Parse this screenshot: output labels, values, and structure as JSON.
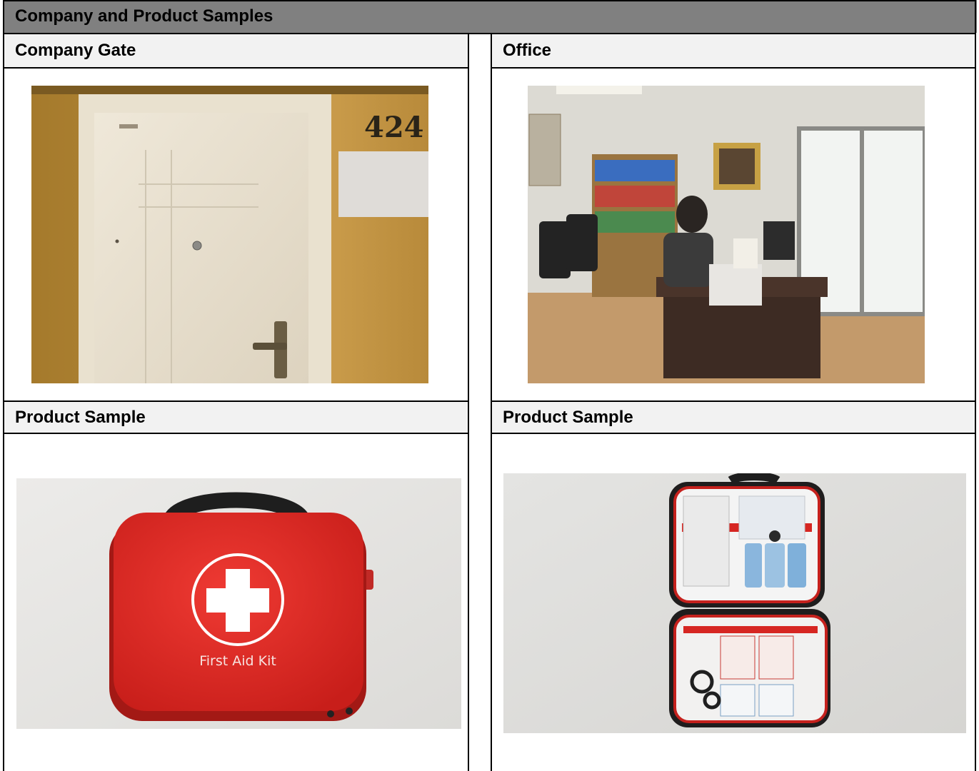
{
  "document": {
    "title": "Company and Product Samples",
    "cells": [
      {
        "label": "Company Gate",
        "photo": "company-door",
        "door_number": "424"
      },
      {
        "label": "Office",
        "photo": "office-room"
      },
      {
        "label": "Product Sample",
        "photo": "first-aid-kit-closed",
        "kit_text": "First Aid Kit"
      },
      {
        "label": "Product Sample",
        "photo": "first-aid-kit-open"
      }
    ]
  }
}
